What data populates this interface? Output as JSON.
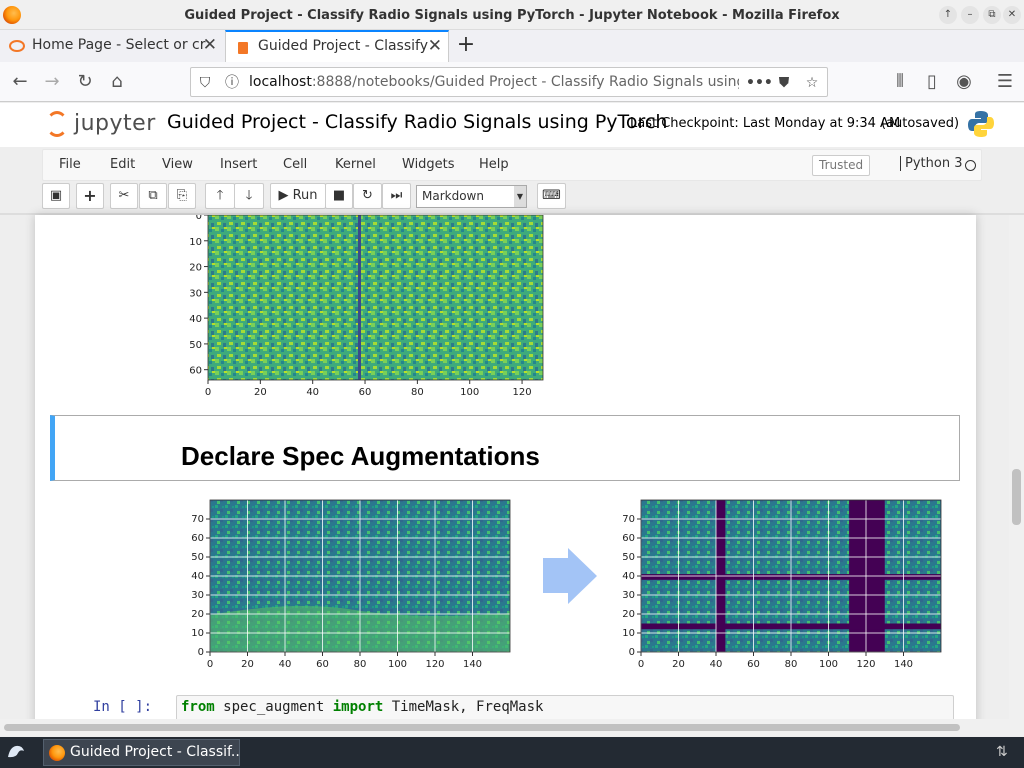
{
  "window": {
    "title": "Guided Project - Classify Radio Signals using PyTorch - Jupyter Notebook - Mozilla Firefox",
    "controls": [
      "↑",
      "–",
      "⧉",
      "✕"
    ]
  },
  "tabs": [
    {
      "label": "Home Page - Select or cr",
      "active": false
    },
    {
      "label": "Guided Project - Classify",
      "active": true
    }
  ],
  "newtab_label": "+",
  "url": {
    "host": "localhost",
    "rest": ":8888/notebooks/Guided Project - Classify Radio Signals using Py",
    "more": "•••"
  },
  "jupyter": {
    "logo_text": "jupyter",
    "notebook_title": "Guided Project - Classify Radio Signals using PyTorch",
    "checkpoint": "Last Checkpoint: Last Monday at 9:34 AM",
    "autosave": "(autosaved)"
  },
  "menu": [
    "File",
    "Edit",
    "View",
    "Insert",
    "Cell",
    "Kernel",
    "Widgets",
    "Help"
  ],
  "trusted": "Trusted",
  "kernel": "Python 3",
  "toolbar": {
    "run_label": "Run",
    "cell_type": "Markdown",
    "icons": [
      "save-icon",
      "plus-icon",
      "cut-icon",
      "copy-icon",
      "paste-icon",
      "arrow-up-icon",
      "arrow-down-icon",
      "run-icon",
      "stop-icon",
      "restart-icon",
      "fast-forward-icon",
      "keyboard-icon"
    ]
  },
  "cells": {
    "heading": "Declare Spec Augmentations",
    "prompt": "In [ ]:",
    "code": {
      "kw1": "from",
      "module": " spec_augment ",
      "kw2": "import",
      "names": " TimeMask, FreqMask"
    }
  },
  "chart_data": [
    {
      "type": "heatmap",
      "xticks": [
        "0",
        "20",
        "40",
        "60",
        "80",
        "100",
        "120"
      ],
      "yticks": [
        "0",
        "10",
        "20",
        "30",
        "40",
        "50",
        "60"
      ],
      "xlim": [
        0,
        128
      ],
      "ylim": [
        64,
        0
      ],
      "features": [
        {
          "kind": "vertical line",
          "x": 59
        }
      ]
    },
    {
      "type": "heatmap",
      "xticks": [
        "0",
        "20",
        "40",
        "60",
        "80",
        "100",
        "120",
        "140"
      ],
      "yticks": [
        "70",
        "60",
        "50",
        "40",
        "30",
        "20",
        "10",
        "0"
      ],
      "xlim": [
        0,
        160
      ],
      "ylim": [
        0,
        80
      ],
      "grid": true
    },
    {
      "type": "heatmap",
      "xticks": [
        "0",
        "20",
        "40",
        "60",
        "80",
        "100",
        "120",
        "140"
      ],
      "yticks": [
        "70",
        "60",
        "50",
        "40",
        "30",
        "20",
        "10",
        "0"
      ],
      "xlim": [
        0,
        160
      ],
      "ylim": [
        0,
        80
      ],
      "grid": true,
      "masks": [
        {
          "axis": "time",
          "from": 40,
          "to": 45
        },
        {
          "axis": "time",
          "from": 111,
          "to": 130
        },
        {
          "axis": "freq",
          "from": 38,
          "to": 41
        },
        {
          "axis": "freq",
          "from": 12,
          "to": 15
        }
      ]
    }
  ],
  "taskbar": {
    "task_label": "Guided Project - Classif..."
  }
}
